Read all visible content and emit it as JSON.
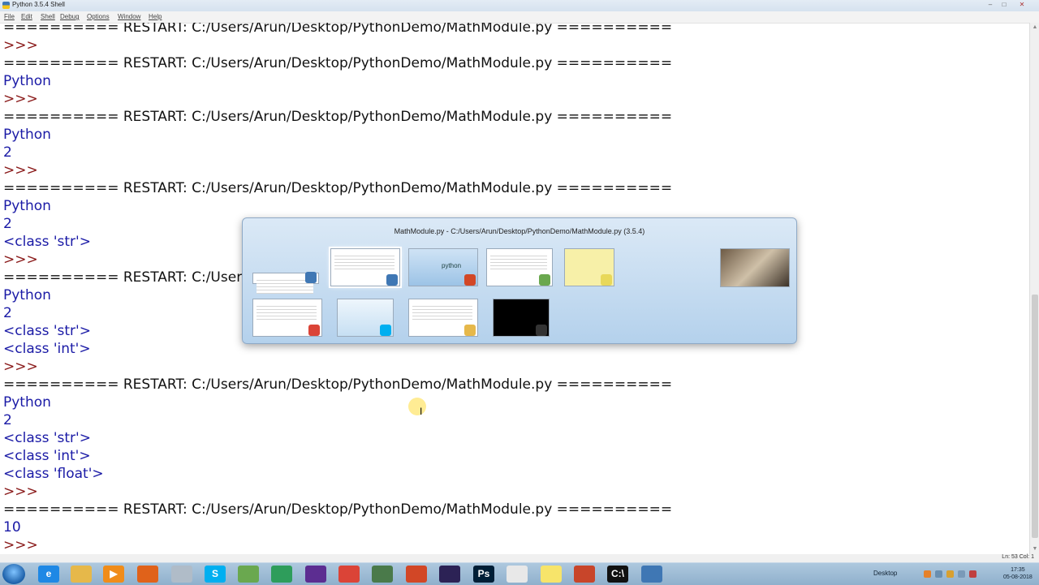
{
  "window": {
    "title": "Python 3.5.4 Shell",
    "controls": {
      "minimize": "–",
      "maximize": "□",
      "close": "✕"
    }
  },
  "menu": [
    "File",
    "Edit",
    "Shell",
    "Debug",
    "Options",
    "Window",
    "Help"
  ],
  "shell_lines": [
    {
      "type": "restart",
      "text": "========== RESTART: C:/Users/Arun/Desktop/PythonDemo/MathModule.py =========="
    },
    {
      "type": "prompt",
      "text": ">>>"
    },
    {
      "type": "restart",
      "text": "========== RESTART: C:/Users/Arun/Desktop/PythonDemo/MathModule.py =========="
    },
    {
      "type": "output",
      "text": "Python"
    },
    {
      "type": "prompt",
      "text": ">>>"
    },
    {
      "type": "restart",
      "text": "========== RESTART: C:/Users/Arun/Desktop/PythonDemo/MathModule.py =========="
    },
    {
      "type": "output",
      "text": "Python"
    },
    {
      "type": "output",
      "text": "2"
    },
    {
      "type": "prompt",
      "text": ">>>"
    },
    {
      "type": "restart",
      "text": "========== RESTART: C:/Users/Arun/Desktop/PythonDemo/MathModule.py =========="
    },
    {
      "type": "output",
      "text": "Python"
    },
    {
      "type": "output",
      "text": "2"
    },
    {
      "type": "output",
      "text": "<class 'str'>"
    },
    {
      "type": "prompt",
      "text": ">>>"
    },
    {
      "type": "restart",
      "text": "========== RESTART: C:/Users/Arun/Desktop/PythonDemo/MathModule.py =========="
    },
    {
      "type": "output",
      "text": "Python"
    },
    {
      "type": "output",
      "text": "2"
    },
    {
      "type": "output",
      "text": "<class 'str'>"
    },
    {
      "type": "output",
      "text": "<class 'int'>"
    },
    {
      "type": "prompt",
      "text": ">>>"
    },
    {
      "type": "restart",
      "text": "========== RESTART: C:/Users/Arun/Desktop/PythonDemo/MathModule.py =========="
    },
    {
      "type": "output",
      "text": "Python"
    },
    {
      "type": "output",
      "text": "2"
    },
    {
      "type": "output",
      "text": "<class 'str'>"
    },
    {
      "type": "output",
      "text": "<class 'int'>"
    },
    {
      "type": "output",
      "text": "<class 'float'>"
    },
    {
      "type": "prompt",
      "text": ">>>"
    },
    {
      "type": "restart",
      "text": "========== RESTART: C:/Users/Arun/Desktop/PythonDemo/MathModule.py =========="
    },
    {
      "type": "output",
      "text": "10"
    },
    {
      "type": "prompt",
      "text": ">>>"
    }
  ],
  "status": {
    "position": "Ln: 53   Col: 1"
  },
  "switcher": {
    "title": "MathModule.py - C:/Users/Arun/Desktop/PythonDemo/MathModule.py (3.5.4)",
    "thumbnails": [
      {
        "name": "python-shell-window",
        "icon": "python-icon",
        "selected": false
      },
      {
        "name": "mathmodule-editor-window",
        "icon": "python-icon",
        "selected": true
      },
      {
        "name": "powerpoint-python-slide",
        "icon": "powerpoint-icon",
        "selected": false,
        "label": "python"
      },
      {
        "name": "notepad-plus-plus-window",
        "icon": "notepadpp-icon",
        "selected": false
      },
      {
        "name": "sticky-notes-window",
        "icon": "sticky-notes-icon",
        "selected": false
      },
      {
        "name": "photo-window",
        "icon": "photo-icon",
        "selected": false
      },
      {
        "name": "chrome-window",
        "icon": "chrome-icon",
        "selected": false
      },
      {
        "name": "skype-window",
        "icon": "skype-icon",
        "selected": false
      },
      {
        "name": "explorer-window",
        "icon": "folder-icon",
        "selected": false
      },
      {
        "name": "command-prompt-window",
        "icon": "cmd-icon",
        "selected": false
      }
    ]
  },
  "taskbar": {
    "apps": [
      {
        "name": "internet-explorer-icon",
        "glyph": "e",
        "color": "#1e88e5"
      },
      {
        "name": "file-explorer-icon",
        "glyph": "",
        "color": "#e6b84a"
      },
      {
        "name": "media-player-icon",
        "glyph": "▶",
        "color": "#f08c1a"
      },
      {
        "name": "firefox-icon",
        "glyph": "",
        "color": "#e0621a"
      },
      {
        "name": "snipping-tool-icon",
        "glyph": "",
        "color": "#b0bcc8"
      },
      {
        "name": "skype-icon",
        "glyph": "S",
        "color": "#00aff0"
      },
      {
        "name": "notepadpp-icon",
        "glyph": "",
        "color": "#6aa84f"
      },
      {
        "name": "pycharm-icon",
        "glyph": "",
        "color": "#2e9d5b"
      },
      {
        "name": "visual-studio-icon",
        "glyph": "",
        "color": "#5c2d91"
      },
      {
        "name": "chrome-icon",
        "glyph": "",
        "color": "#db4437"
      },
      {
        "name": "task-manager-icon",
        "glyph": "",
        "color": "#4a7a4a"
      },
      {
        "name": "powerpoint-icon",
        "glyph": "",
        "color": "#d24726"
      },
      {
        "name": "eclipse-icon",
        "glyph": "",
        "color": "#2c2255"
      },
      {
        "name": "photoshop-icon",
        "glyph": "Ps",
        "color": "#001e36"
      },
      {
        "name": "java-icon",
        "glyph": "",
        "color": "#e8e8e8"
      },
      {
        "name": "sticky-notes-icon",
        "glyph": "",
        "color": "#f7e46a"
      },
      {
        "name": "powerpoint-icon-2",
        "glyph": "",
        "color": "#c8452a"
      },
      {
        "name": "cmd-icon",
        "glyph": "C:\\",
        "color": "#111111"
      },
      {
        "name": "python-idle-icon",
        "glyph": "",
        "color": "#3f77b4"
      }
    ],
    "tray": {
      "desktop_label": "Desktop",
      "time": "17:35",
      "date": "05-08-2018"
    }
  }
}
